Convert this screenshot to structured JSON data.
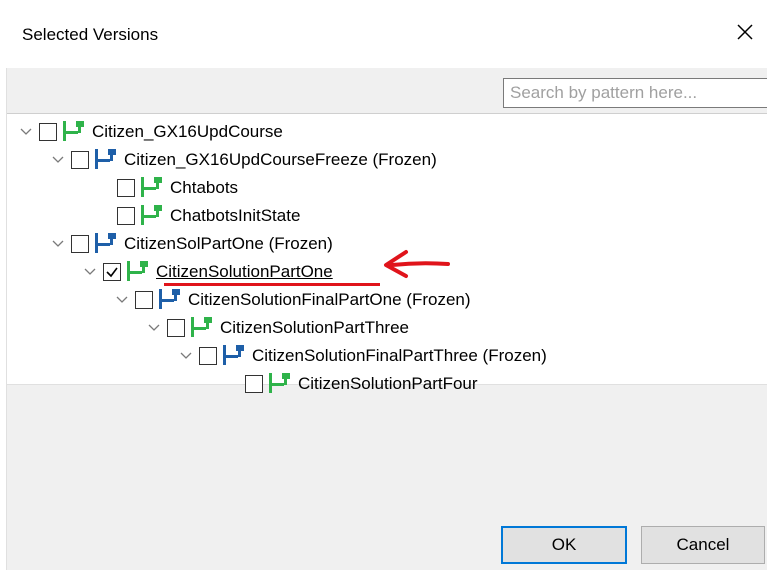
{
  "dialog": {
    "title": "Selected Versions",
    "close_icon": "close-icon",
    "search": {
      "placeholder": "Search by pattern here...",
      "value": ""
    },
    "tree": [
      {
        "label": "Citizen_GX16UpdCourse",
        "expanded": true,
        "checked": false,
        "icon": "version-tree-green-icon"
      },
      {
        "label": "Citizen_GX16UpdCourseFreeze (Frozen)",
        "expanded": true,
        "checked": false,
        "icon": "version-tree-blue-frozen-icon"
      },
      {
        "label": "Chtabots",
        "expanded": null,
        "checked": false,
        "icon": "version-tree-green-icon"
      },
      {
        "label": "ChatbotsInitState",
        "expanded": null,
        "checked": false,
        "icon": "version-tree-green-icon"
      },
      {
        "label": "CitizenSolPartOne (Frozen)",
        "expanded": true,
        "checked": false,
        "icon": "version-tree-blue-frozen-icon"
      },
      {
        "label": "CitizenSolutionPartOne",
        "expanded": true,
        "checked": true,
        "icon": "version-tree-green-icon"
      },
      {
        "label": "CitizenSolutionFinalPartOne (Frozen)",
        "expanded": true,
        "checked": false,
        "icon": "version-tree-blue-frozen-icon"
      },
      {
        "label": "CitizenSolutionPartThree",
        "expanded": true,
        "checked": false,
        "icon": "version-tree-green-icon"
      },
      {
        "label": "CitizenSolutionFinalPartThree (Frozen)",
        "expanded": true,
        "checked": false,
        "icon": "version-tree-blue-frozen-icon"
      },
      {
        "label": "CitizenSolutionPartFour",
        "expanded": null,
        "checked": false,
        "icon": "version-tree-green-icon"
      }
    ],
    "annotation": {
      "icon": "red-arrow-icon",
      "color": "#e0141b"
    },
    "buttons": {
      "ok": "OK",
      "cancel": "Cancel"
    },
    "colors": {
      "accent": "#0078d7",
      "green": "#2fb34a",
      "blue": "#1e5fa8"
    }
  }
}
